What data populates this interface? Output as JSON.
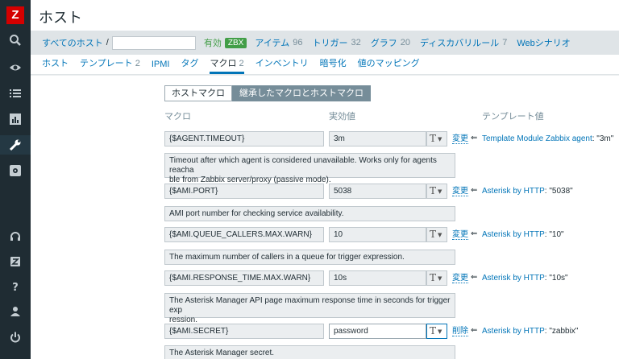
{
  "sidebar": {
    "logo": "Z",
    "icons": [
      "search-icon",
      "monitoring-eye-icon",
      "inventory-list-icon",
      "reports-chart-icon",
      "configuration-wrench-icon",
      "administration-gear-icon",
      "support-headset-icon",
      "share-z-icon",
      "help-icon",
      "user-profile-icon",
      "sign-out-icon"
    ]
  },
  "header": {
    "title": "ホスト"
  },
  "filter": {
    "all_hosts": "すべてのホスト",
    "separator": "/",
    "status": "有効",
    "badge": "ZBX",
    "links": [
      {
        "label": "アイテム",
        "count": "96"
      },
      {
        "label": "トリガー",
        "count": "32"
      },
      {
        "label": "グラフ",
        "count": "20"
      },
      {
        "label": "ディスカバリルール",
        "count": "7"
      },
      {
        "label": "Webシナリオ",
        "count": ""
      }
    ]
  },
  "tabs": [
    {
      "label": "ホスト",
      "count": ""
    },
    {
      "label": "テンプレート",
      "count": "2"
    },
    {
      "label": "IPMI",
      "count": ""
    },
    {
      "label": "タグ",
      "count": ""
    },
    {
      "label": "マクロ",
      "count": "2"
    },
    {
      "label": "インベントリ",
      "count": ""
    },
    {
      "label": "暗号化",
      "count": ""
    },
    {
      "label": "値のマッピング",
      "count": ""
    }
  ],
  "toggle": {
    "host_macros": "ホストマクロ",
    "inherited": "継承したマクロとホストマクロ"
  },
  "columns": {
    "macro": "マクロ",
    "effective_value": "実効値",
    "template_value": "テンプレート値"
  },
  "type_symbol": "T",
  "arrow": "⇐",
  "rows": [
    {
      "macro": "{$AGENT.TIMEOUT}",
      "value": "3m",
      "action": "変更",
      "template": "Template Module Zabbix agent",
      "template_value": ": \"3m\"",
      "description": "Timeout after which agent is considered unavailable. Works only for agents reacha\nble from Zabbix server/proxy (passive mode)."
    },
    {
      "macro": "{$AMI.PORT}",
      "value": "5038",
      "action": "変更",
      "template": "Asterisk by HTTP",
      "template_value": ": \"5038\"",
      "description": "AMI port number for checking service availability."
    },
    {
      "macro": "{$AMI.QUEUE_CALLERS.MAX.WARN}",
      "value": "10",
      "action": "変更",
      "template": "Asterisk by HTTP",
      "template_value": ": \"10\"",
      "description": "The maximum number of callers in a queue for trigger expression."
    },
    {
      "macro": "{$AMI.RESPONSE_TIME.MAX.WARN}",
      "value": "10s",
      "action": "変更",
      "template": "Asterisk by HTTP",
      "template_value": ": \"10s\"",
      "description": "The Asterisk Manager API page maximum response time in seconds for trigger exp\nression."
    },
    {
      "macro": "{$AMI.SECRET}",
      "value": "password",
      "action": "削除",
      "template": "Asterisk by HTTP",
      "template_value": ": \"zabbix\"",
      "description": "The Asterisk Manager secret."
    }
  ]
}
